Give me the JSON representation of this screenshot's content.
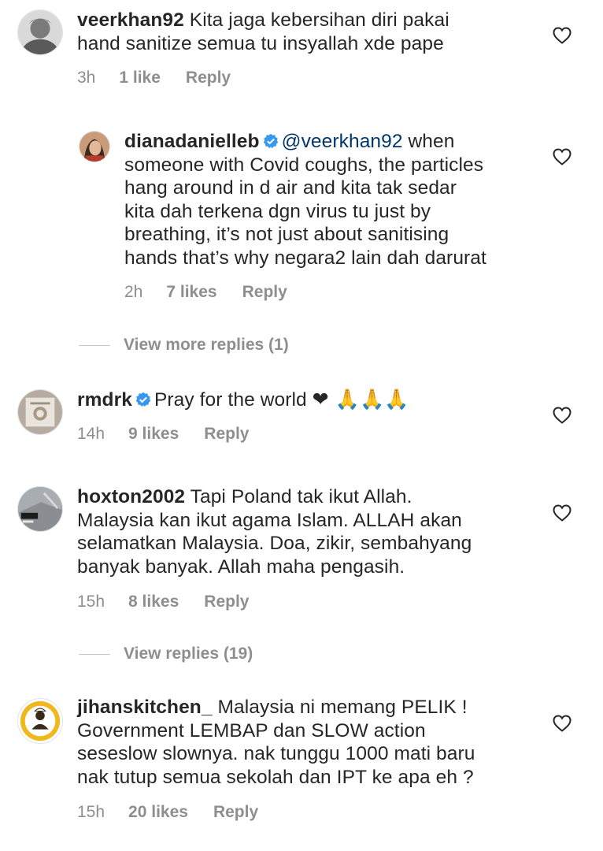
{
  "comments": [
    {
      "username": "veerkhan92",
      "lines": [
        "Kita jaga kebersihan diri pakai",
        "hand sanitize semua tu insyallah xde pape"
      ],
      "time": "3h",
      "likes": "1 like",
      "reply": "Reply"
    },
    {
      "username": "dianadanielleb",
      "mention": "@veerkhan92",
      "first_line_rest": " when",
      "lines": [
        "someone with Covid coughs, the particles",
        "hang around in d air and kita tak sedar",
        "kita dah terkena dgn virus tu just by",
        "breathing, it’s not just about sanitising",
        "hands that’s why negara2 lain dah darurat"
      ],
      "time": "2h",
      "likes": "7 likes",
      "reply": "Reply"
    },
    {
      "username": "rmdrk",
      "body": "Pray for the world",
      "emojis": "❤ 🙏🙏🙏",
      "time": "14h",
      "likes": "9 likes",
      "reply": "Reply"
    },
    {
      "username": "hoxton2002",
      "first_line_rest": " Tapi Poland tak ikut Allah.",
      "lines": [
        "Malaysia kan ikut agama Islam. ALLAH akan",
        "selamatkan Malaysia. Doa, zikir, sembahyang",
        "banyak banyak. Allah maha pengasih."
      ],
      "time": "15h",
      "likes": "8 likes",
      "reply": "Reply"
    },
    {
      "username": "jihanskitchen_",
      "first_line_rest": " Malaysia ni memang PELIK !",
      "lines": [
        "Government LEMBAP dan SLOW action",
        "seseslow slownya. nak tunggu 1000 mati baru",
        "nak tutup semua sekolah dan IPT ke apa eh ?"
      ],
      "time": "15h",
      "likes": "20 likes",
      "reply": "Reply"
    }
  ],
  "view_more_replies": "View more replies (1)",
  "view_replies": "View replies (19)",
  "icons": {
    "heart": "heart-outline-icon",
    "verified": "verified-badge-icon"
  },
  "colors": {
    "text": "#262626",
    "meta": "#8e8e8e",
    "mention": "#00376b",
    "verified": "#3897f0"
  }
}
